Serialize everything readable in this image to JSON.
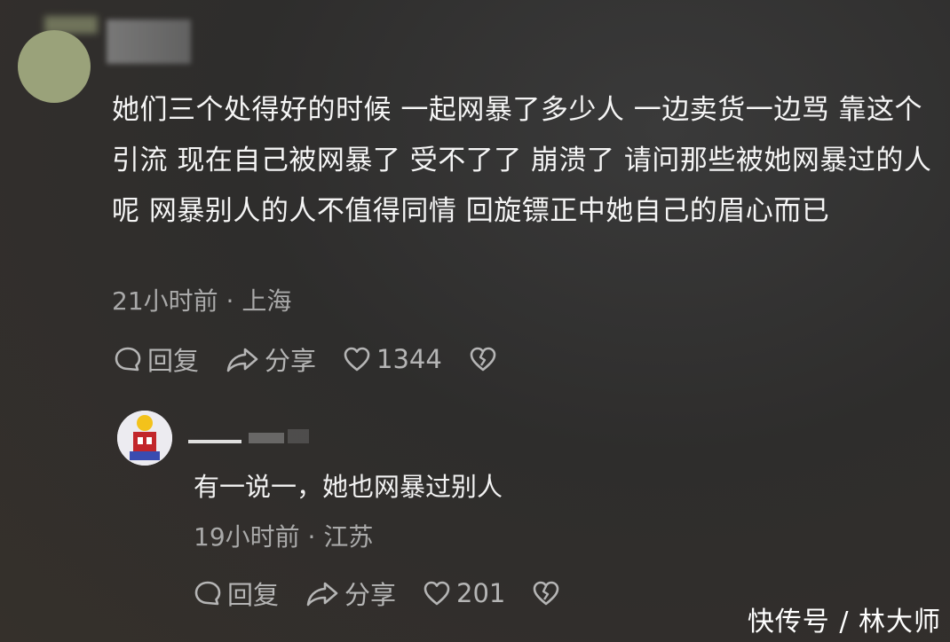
{
  "comment": {
    "text": "她们三个处得好的时候 一起网暴了多少人 一边卖货一边骂 靠这个引流 现在自己被网暴了 受不了了 崩溃了 请问那些被她网暴过的人呢 网暴别人的人不值得同情 回旋镖正中她自己的眉心而已",
    "meta": "21小时前 · 上海",
    "reply_label": "回复",
    "share_label": "分享",
    "likes": "1344"
  },
  "reply": {
    "text": "有一说一，她也网暴过别人",
    "meta": "19小时前 · 江苏",
    "reply_label": "回复",
    "share_label": "分享",
    "likes": "201"
  },
  "watermark": "快传号 / 林大师",
  "icons": [
    "comment-bubble-icon",
    "share-arrow-icon",
    "heart-icon",
    "broken-heart-icon"
  ]
}
